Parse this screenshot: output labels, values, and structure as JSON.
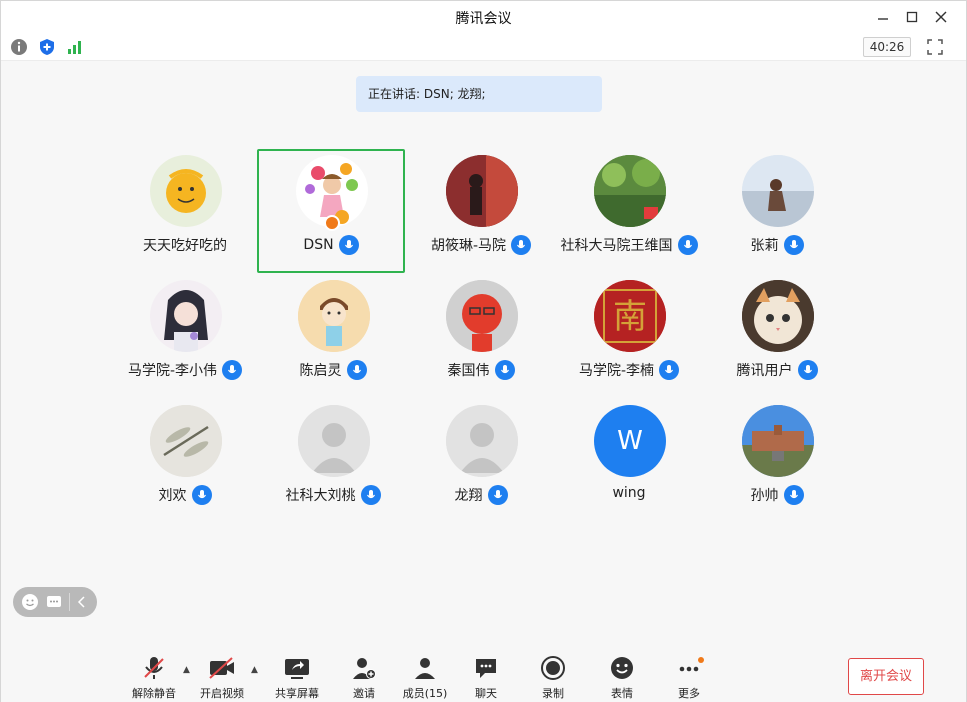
{
  "window": {
    "title": "腾讯会议"
  },
  "toolbar": {
    "timer": "40:26"
  },
  "speaking": {
    "text": "正在讲话: DSN; 龙翔;"
  },
  "participants": [
    {
      "name": "天天吃好吃的",
      "avatar": "orange-cartoon",
      "mic": false,
      "active": false
    },
    {
      "name": "DSN",
      "avatar": "girl-flowers",
      "mic": true,
      "active": true
    },
    {
      "name": "胡筱琳-马院",
      "avatar": "red-room-photo",
      "mic": true,
      "active": false
    },
    {
      "name": "社科大马院王维国",
      "avatar": "green-forest-photo",
      "mic": true,
      "active": false
    },
    {
      "name": "张莉",
      "avatar": "seaside-girl-photo",
      "mic": true,
      "active": false
    },
    {
      "name": "马学院-李小伟",
      "avatar": "anime-girl",
      "mic": true,
      "active": false
    },
    {
      "name": "陈启灵",
      "avatar": "cartoon-boy",
      "mic": true,
      "active": false
    },
    {
      "name": "秦国伟",
      "avatar": "red-glasses-man",
      "mic": true,
      "active": false
    },
    {
      "name": "马学院-李楠",
      "avatar": "red-calligraphy",
      "mic": true,
      "active": false
    },
    {
      "name": "腾讯用户",
      "avatar": "cat-photo",
      "mic": true,
      "active": false
    },
    {
      "name": "刘欢",
      "avatar": "dragonfly-photo",
      "mic": true,
      "active": false
    },
    {
      "name": "社科大刘桃",
      "avatar": "default-person",
      "mic": true,
      "active": false
    },
    {
      "name": "龙翔",
      "avatar": "default-person",
      "mic": true,
      "active": false
    },
    {
      "name": "wing",
      "avatar": "letter",
      "letter": "W",
      "mic": false,
      "active": false
    },
    {
      "name": "孙帅",
      "avatar": "building-photo",
      "mic": true,
      "active": false
    }
  ],
  "bottom": {
    "unmute": "解除静音",
    "video": "开启视频",
    "share": "共享屏幕",
    "invite": "邀请",
    "members": "成员(15)",
    "chat": "聊天",
    "record": "录制",
    "emoji": "表情",
    "more": "更多",
    "leave": "离开会议"
  },
  "colors": {
    "accent": "#1e7ff0",
    "active_border": "#2fb34f",
    "leave": "#e04848",
    "speaking_bg": "#dbe9fb"
  }
}
